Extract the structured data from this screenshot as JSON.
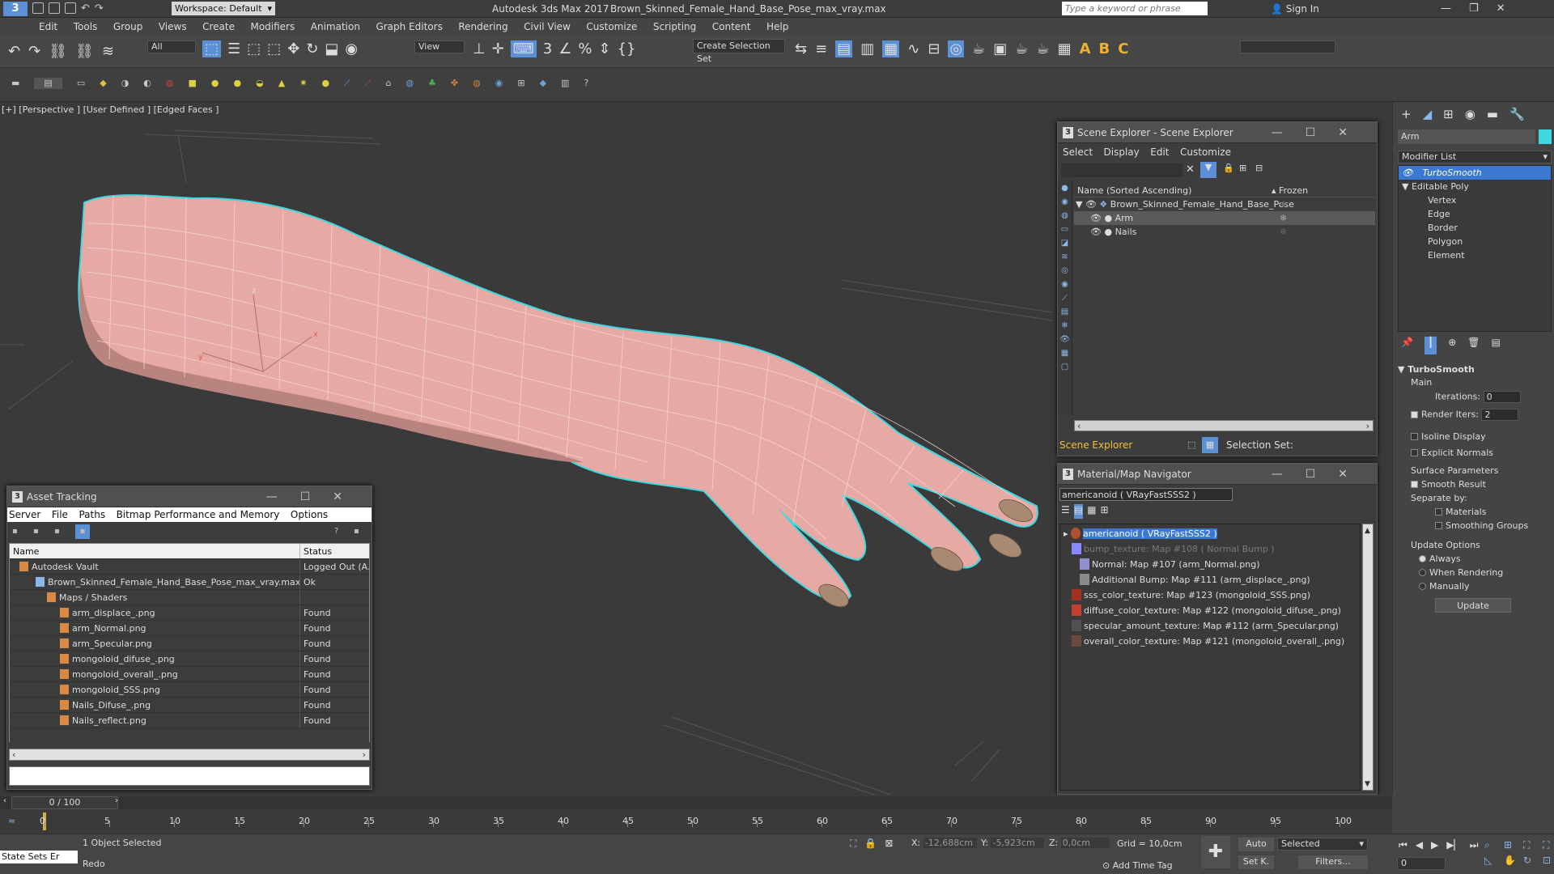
{
  "title": {
    "workspace": "Workspace: Default",
    "app": "Autodesk 3ds Max 2017",
    "file": "Brown_Skinned_Female_Hand_Base_Pose_max_vray.max",
    "search_placeholder": "Type a keyword or phrase",
    "sign_in": "Sign In"
  },
  "menu": [
    "Edit",
    "Tools",
    "Group",
    "Views",
    "Create",
    "Modifiers",
    "Animation",
    "Graph Editors",
    "Rendering",
    "Civil View",
    "Customize",
    "Scripting",
    "Content",
    "Help"
  ],
  "toolbar": {
    "filter": "All",
    "refcoord": "View",
    "selection_set": "Create Selection Set"
  },
  "viewport": {
    "label": "[+] [Perspective ] [User Defined ] [Edged Faces ]",
    "axis_x": "x",
    "axis_y": "y",
    "axis_z": "z"
  },
  "scene_explorer": {
    "title": "Scene Explorer - Scene Explorer",
    "menu": [
      "Select",
      "Display",
      "Edit",
      "Customize"
    ],
    "col_name": "Name (Sorted Ascending)",
    "col_frozen": "▴ Frozen",
    "items": [
      {
        "name": "Brown_Skinned_Female_Hand_Base_Pose",
        "level": 0
      },
      {
        "name": "Arm",
        "level": 1
      },
      {
        "name": "Nails",
        "level": 1
      }
    ],
    "footer_label": "Scene Explorer",
    "selection_set": "Selection Set:"
  },
  "asset_tracking": {
    "title": "Asset Tracking",
    "menu": [
      "Server",
      "File",
      "Paths",
      "Bitmap Performance and Memory",
      "Options"
    ],
    "col_name": "Name",
    "col_status": "Status",
    "rows": [
      {
        "name": "Autodesk Vault",
        "status": "Logged Out (A...",
        "indent": 0
      },
      {
        "name": "Brown_Skinned_Female_Hand_Base_Pose_max_vray.max",
        "status": "Ok",
        "indent": 1
      },
      {
        "name": "Maps / Shaders",
        "status": "",
        "indent": 2
      },
      {
        "name": "arm_displace_.png",
        "status": "Found",
        "indent": 3
      },
      {
        "name": "arm_Normal.png",
        "status": "Found",
        "indent": 3
      },
      {
        "name": "arm_Specular.png",
        "status": "Found",
        "indent": 3
      },
      {
        "name": "mongoloid_difuse_.png",
        "status": "Found",
        "indent": 3
      },
      {
        "name": "mongoloid_overall_.png",
        "status": "Found",
        "indent": 3
      },
      {
        "name": "mongoloid_SSS.png",
        "status": "Found",
        "indent": 3
      },
      {
        "name": "Nails_Difuse_.png",
        "status": "Found",
        "indent": 3
      },
      {
        "name": "Nails_reflect.png",
        "status": "Found",
        "indent": 3
      }
    ]
  },
  "material_navigator": {
    "title": "Material/Map Navigator",
    "current": "americanoid  ( VRayFastSSS2 )",
    "tree": [
      {
        "label": "americanoid  ( VRayFastSSS2 )",
        "color": "#b05030",
        "indent": 0,
        "selected": true
      },
      {
        "label": "bump_texture: Map #108  ( Normal Bump )",
        "color": "#8888ff",
        "indent": 1,
        "dim": true
      },
      {
        "label": "Normal: Map #107 (arm_Normal.png)",
        "color": "#8f8fd0",
        "indent": 2
      },
      {
        "label": "Additional Bump: Map #111 (arm_displace_.png)",
        "color": "#8a8a8a",
        "indent": 2
      },
      {
        "label": "sss_color_texture: Map #123 (mongoloid_SSS.png)",
        "color": "#a03020",
        "indent": 1
      },
      {
        "label": "diffuse_color_texture: Map #122 (mongoloid_difuse_.png)",
        "color": "#c04030",
        "indent": 1
      },
      {
        "label": "specular_amount_texture: Map #112 (arm_Specular.png)",
        "color": "#505050",
        "indent": 1
      },
      {
        "label": "overall_color_texture: Map #121 (mongoloid_overall_.png)",
        "color": "#6a4a3a",
        "indent": 1
      }
    ]
  },
  "command_panel": {
    "object_name": "Arm",
    "modifier_list": "Modifier List",
    "stack": [
      {
        "label": "TurboSmooth",
        "selected": true,
        "indent": 0
      },
      {
        "label": "Editable Poly",
        "indent": 0
      },
      {
        "label": "Vertex",
        "indent": 1
      },
      {
        "label": "Edge",
        "indent": 1
      },
      {
        "label": "Border",
        "indent": 1
      },
      {
        "label": "Polygon",
        "indent": 1
      },
      {
        "label": "Element",
        "indent": 1
      }
    ],
    "rollout_title": "TurboSmooth",
    "main": "Main",
    "iterations_label": "Iterations:",
    "iterations": "0",
    "render_iters_label": "Render Iters:",
    "render_iters": "2",
    "isoline": "Isoline Display",
    "explicit": "Explicit Normals",
    "surface_params": "Surface Parameters",
    "smooth_result": "Smooth Result",
    "separate_by": "Separate by:",
    "materials": "Materials",
    "smoothing_groups": "Smoothing Groups",
    "update_options": "Update Options",
    "always": "Always",
    "when_rendering": "When Rendering",
    "manually": "Manually",
    "update_button": "Update"
  },
  "timeline": {
    "frame": "0 / 100",
    "ticks": [
      "0",
      "5",
      "10",
      "15",
      "20",
      "25",
      "30",
      "35",
      "40",
      "45",
      "50",
      "55",
      "60",
      "65",
      "70",
      "75",
      "80",
      "85",
      "90",
      "95",
      "100"
    ]
  },
  "status": {
    "state_sets": "State Sets Er",
    "selected": "1 Object Selected",
    "prompt": "Redo",
    "x_label": "X:",
    "x": "-12,688cm",
    "y_label": "Y:",
    "y": "-5,923cm",
    "z_label": "Z:",
    "z": "0,0cm",
    "grid": "Grid = 10,0cm",
    "add_time_tag": "Add Time Tag",
    "auto": "Auto",
    "set_k": "Set K.",
    "key_mode": "Selected",
    "filters": "Filters...",
    "frame": "0"
  },
  "colors": {
    "selection_outline": "#3fd8e0",
    "skin": "#e6a9a4",
    "accent": "#4a82d8"
  }
}
